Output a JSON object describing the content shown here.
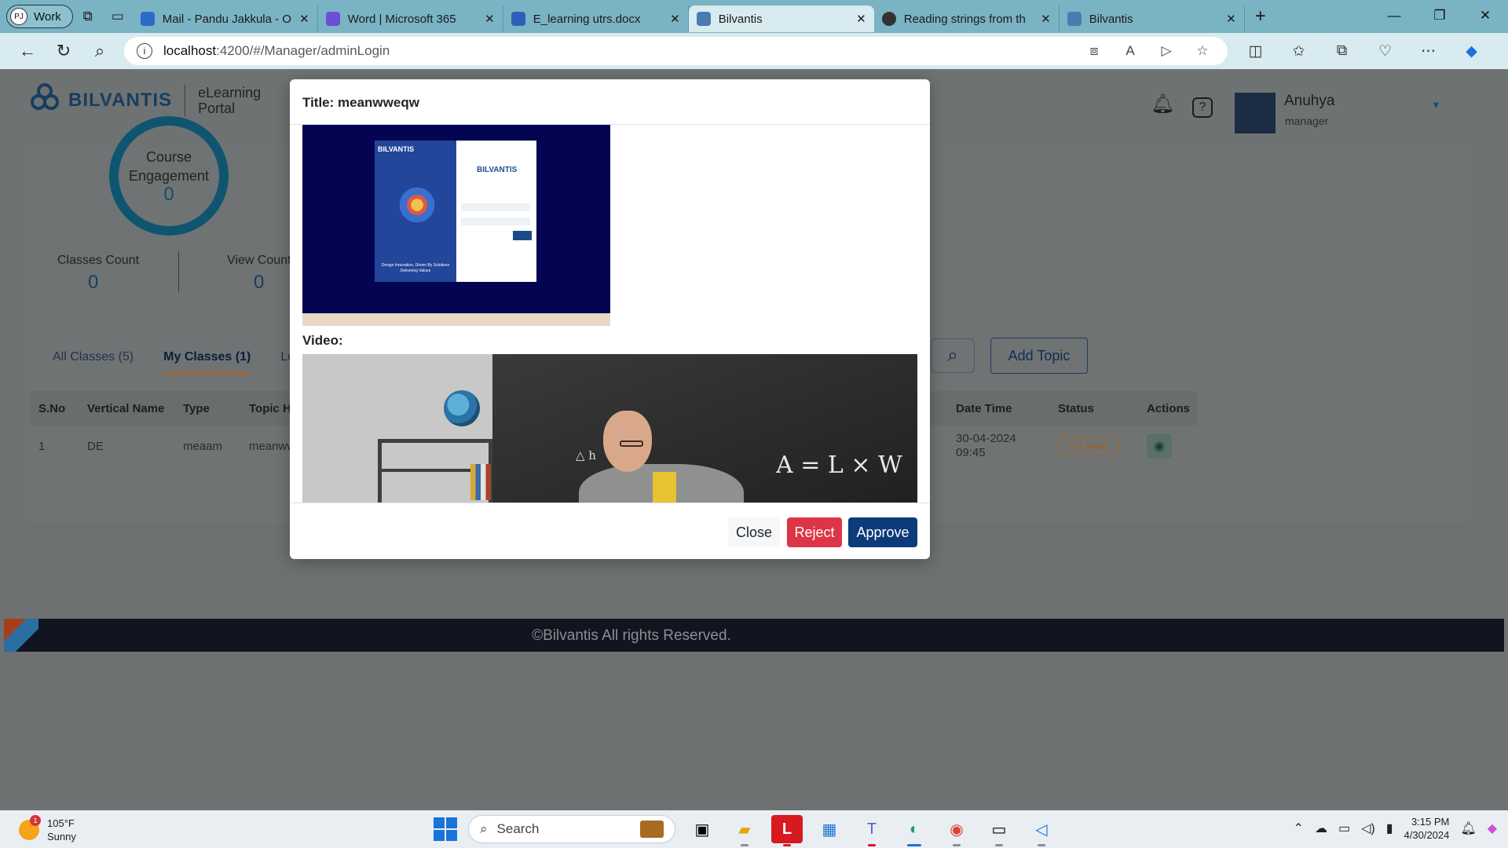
{
  "browser": {
    "profile_initials": "PJ",
    "profile_label": "Work",
    "tabs": [
      {
        "title": "Mail - Pandu Jakkula - O",
        "color": "#2b6cc4"
      },
      {
        "title": "Word | Microsoft 365",
        "color": "#6b4fd8"
      },
      {
        "title": "E_learning utrs.docx",
        "color": "#2b5fb8"
      },
      {
        "title": "Bilvantis",
        "color": "#4a7bb0"
      },
      {
        "title": "Reading strings from th",
        "color": "#333333"
      },
      {
        "title": "Bilvantis",
        "color": "#4a7bb0"
      }
    ],
    "url_host": "localhost",
    "url_rest": ":4200/#/Manager/adminLogin"
  },
  "app": {
    "brand": "BILVANTIS",
    "brand_sub_line1": "eLearning",
    "brand_sub_line2": "Portal",
    "user_name": "Anuhya",
    "user_role": "manager",
    "stats": {
      "course_engagement_label_1": "Course",
      "course_engagement_label_2": "Engagement",
      "course_engagement_value": "0",
      "classes_count_label": "Classes Count",
      "classes_count_value": "0",
      "view_count_label": "View Count",
      "view_count_value": "0"
    },
    "tabs": [
      "All Classes (5)",
      "My Classes (1)",
      "Leads"
    ],
    "add_topic_label": "Add Topic",
    "table": {
      "headers": [
        "S.No",
        "Vertical Name",
        "Type",
        "Topic Hea",
        "Date Time",
        "Status",
        "Actions"
      ],
      "row": {
        "sno": "1",
        "vertical": "DE",
        "type": "meaam",
        "topic": "meanww",
        "date": "30-04-2024",
        "time": "09:45",
        "status": "On Hold"
      }
    },
    "footer": "©Bilvantis All rights Reserved."
  },
  "modal": {
    "title": "Title: meanwweqw",
    "video_label": "Video:",
    "thumb_brand": "BILVANTIS",
    "thumb_tagline": "Design Innovation, Driven By Solutions Delivering Values",
    "video_formula": "A = L × W",
    "close_label": "Close",
    "reject_label": "Reject",
    "approve_label": "Approve",
    "colors": {
      "reject": "#dc3545",
      "approve": "#0c3b7a"
    }
  },
  "taskbar": {
    "weather_temp": "105°F",
    "weather_desc": "Sunny",
    "weather_badge": "1",
    "search_label": "Search",
    "time": "3:15 PM",
    "date": "4/30/2024"
  }
}
